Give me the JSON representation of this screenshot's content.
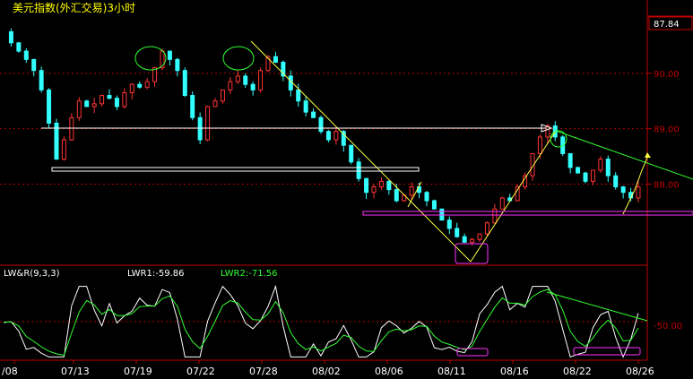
{
  "title": "美元指数(外汇交易)3小时",
  "colors": {
    "up": "#ff3333",
    "down": "#33ffff",
    "grid": "#b00000",
    "axis": "#c00000",
    "text": "#ffffff",
    "title": "#ffff00",
    "annot_yellow": "#ffff44",
    "annot_white": "#ffffff",
    "annot_magenta": "#ff33ff",
    "annot_green": "#33ff33",
    "lwr1": "#ffffff",
    "lwr2": "#33ff33"
  },
  "price_axis": {
    "top_label": "87.84",
    "ticks": [
      {
        "label": "90.00",
        "value": 90.0
      },
      {
        "label": "89.00",
        "value": 89.0
      },
      {
        "label": "88.00",
        "value": 88.0
      }
    ]
  },
  "indicator": {
    "name": "LW&R(9,3,3)",
    "lwr1_label": "LWR1:-59.86",
    "lwr2_label": "LWR2:-71.56",
    "tick": {
      "label": "-50.00",
      "value": -50
    }
  },
  "date_labels": [
    "/08",
    "07/13",
    "07/19",
    "07/22",
    "07/28",
    "08/02",
    "08/06",
    "08/11",
    "08/16",
    "08/22",
    "08/26"
  ],
  "chart_data": {
    "type": "candlestick",
    "title": "美元指数(外汇交易)3小时",
    "ylim": [
      86.6,
      91.0
    ],
    "indicator_ylim": [
      -100,
      0
    ],
    "closes": [
      90.75,
      90.55,
      90.4,
      90.25,
      90.05,
      89.7,
      89.1,
      88.45,
      88.8,
      89.2,
      89.5,
      89.4,
      89.45,
      89.6,
      89.55,
      89.4,
      89.65,
      89.8,
      89.75,
      89.85,
      90.1,
      90.4,
      90.25,
      90.05,
      89.6,
      89.2,
      88.8,
      89.4,
      89.5,
      89.7,
      89.85,
      89.95,
      89.8,
      89.7,
      90.05,
      90.3,
      90.2,
      89.95,
      89.7,
      89.5,
      89.3,
      89.2,
      88.95,
      88.8,
      88.95,
      88.7,
      88.4,
      88.1,
      87.85,
      87.95,
      88.05,
      87.9,
      87.7,
      87.8,
      87.95,
      87.85,
      87.7,
      87.55,
      87.35,
      87.2,
      87.05,
      86.95,
      87.0,
      87.1,
      87.3,
      87.55,
      87.75,
      87.7,
      87.95,
      88.15,
      88.55,
      88.85,
      89.05,
      88.85,
      88.55,
      88.3,
      88.2,
      88.05,
      88.25,
      88.45,
      88.15,
      87.95,
      87.85,
      87.75,
      87.95
    ]
  }
}
